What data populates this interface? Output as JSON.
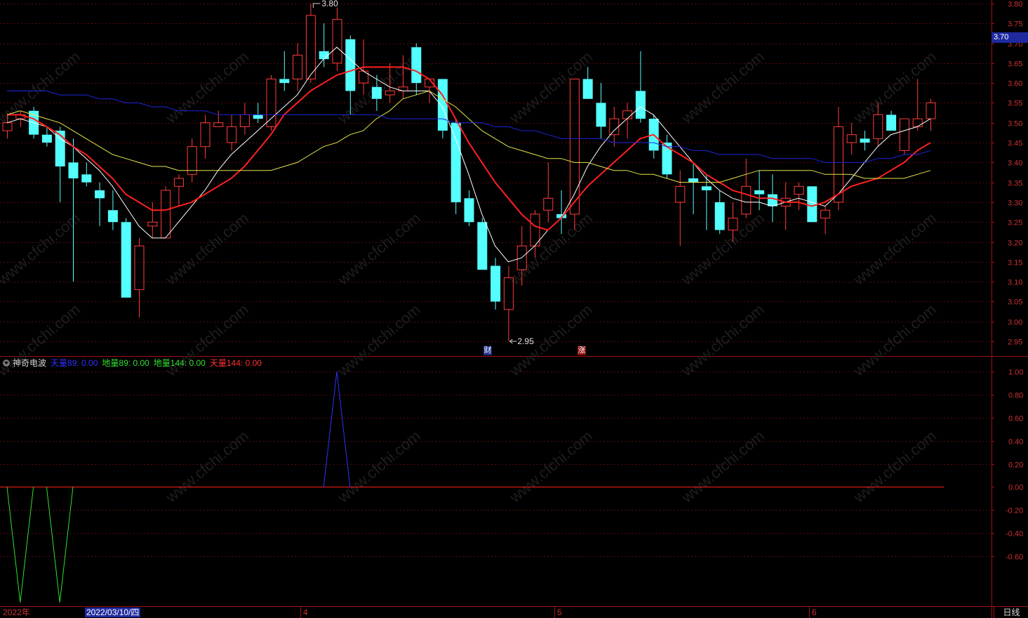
{
  "chart_data": [
    {
      "type": "candlestick",
      "ylim": [
        2.91,
        3.82
      ],
      "y_ticks": [
        "3.80",
        "3.75",
        "3.70",
        "3.65",
        "3.60",
        "3.55",
        "3.50",
        "3.45",
        "3.40",
        "3.35",
        "3.30",
        "3.25",
        "3.20",
        "3.15",
        "3.10",
        "3.05",
        "3.00",
        "2.95"
      ],
      "current_price": "3.70",
      "high_label": "3.80",
      "low_label": "2.95",
      "candles": [
        {
          "o": 3.48,
          "h": 3.52,
          "l": 3.46,
          "c": 3.5
        },
        {
          "o": 3.51,
          "h": 3.53,
          "l": 3.49,
          "c": 3.52
        },
        {
          "o": 3.53,
          "h": 3.54,
          "l": 3.46,
          "c": 3.47
        },
        {
          "o": 3.47,
          "h": 3.49,
          "l": 3.44,
          "c": 3.45
        },
        {
          "o": 3.48,
          "h": 3.49,
          "l": 3.3,
          "c": 3.39
        },
        {
          "o": 3.4,
          "h": 3.46,
          "l": 3.1,
          "c": 3.36
        },
        {
          "o": 3.37,
          "h": 3.4,
          "l": 3.34,
          "c": 3.35
        },
        {
          "o": 3.33,
          "h": 3.35,
          "l": 3.24,
          "c": 3.31
        },
        {
          "o": 3.28,
          "h": 3.33,
          "l": 3.23,
          "c": 3.25
        },
        {
          "o": 3.25,
          "h": 3.26,
          "l": 3.06,
          "c": 3.06
        },
        {
          "o": 3.08,
          "h": 3.21,
          "l": 3.01,
          "c": 3.19
        },
        {
          "o": 3.24,
          "h": 3.3,
          "l": 3.21,
          "c": 3.25
        },
        {
          "o": 3.21,
          "h": 3.34,
          "l": 3.21,
          "c": 3.33
        },
        {
          "o": 3.34,
          "h": 3.37,
          "l": 3.29,
          "c": 3.36
        },
        {
          "o": 3.37,
          "h": 3.46,
          "l": 3.35,
          "c": 3.44
        },
        {
          "o": 3.44,
          "h": 3.52,
          "l": 3.41,
          "c": 3.5
        },
        {
          "o": 3.49,
          "h": 3.53,
          "l": 3.49,
          "c": 3.5
        },
        {
          "o": 3.45,
          "h": 3.52,
          "l": 3.43,
          "c": 3.49
        },
        {
          "o": 3.49,
          "h": 3.55,
          "l": 3.47,
          "c": 3.52
        },
        {
          "o": 3.52,
          "h": 3.55,
          "l": 3.5,
          "c": 3.51
        },
        {
          "o": 3.49,
          "h": 3.62,
          "l": 3.48,
          "c": 3.61
        },
        {
          "o": 3.61,
          "h": 3.68,
          "l": 3.58,
          "c": 3.6
        },
        {
          "o": 3.61,
          "h": 3.7,
          "l": 3.58,
          "c": 3.67
        },
        {
          "o": 3.61,
          "h": 3.8,
          "l": 3.6,
          "c": 3.77
        },
        {
          "o": 3.68,
          "h": 3.75,
          "l": 3.64,
          "c": 3.66
        },
        {
          "o": 3.65,
          "h": 3.79,
          "l": 3.63,
          "c": 3.76
        },
        {
          "o": 3.71,
          "h": 3.72,
          "l": 3.52,
          "c": 3.58
        },
        {
          "o": 3.6,
          "h": 3.71,
          "l": 3.57,
          "c": 3.63
        },
        {
          "o": 3.59,
          "h": 3.62,
          "l": 3.53,
          "c": 3.56
        },
        {
          "o": 3.57,
          "h": 3.65,
          "l": 3.55,
          "c": 3.58
        },
        {
          "o": 3.58,
          "h": 3.67,
          "l": 3.56,
          "c": 3.59
        },
        {
          "o": 3.69,
          "h": 3.7,
          "l": 3.57,
          "c": 3.6
        },
        {
          "o": 3.59,
          "h": 3.61,
          "l": 3.55,
          "c": 3.61
        },
        {
          "o": 3.61,
          "h": 3.61,
          "l": 3.46,
          "c": 3.48
        },
        {
          "o": 3.5,
          "h": 3.51,
          "l": 3.27,
          "c": 3.3
        },
        {
          "o": 3.31,
          "h": 3.33,
          "l": 3.24,
          "c": 3.25
        },
        {
          "o": 3.25,
          "h": 3.26,
          "l": 3.13,
          "c": 3.13
        },
        {
          "o": 3.14,
          "h": 3.16,
          "l": 3.03,
          "c": 3.05
        },
        {
          "o": 3.03,
          "h": 3.14,
          "l": 2.95,
          "c": 3.11
        },
        {
          "o": 3.13,
          "h": 3.24,
          "l": 3.09,
          "c": 3.19
        },
        {
          "o": 3.19,
          "h": 3.28,
          "l": 3.16,
          "c": 3.27
        },
        {
          "o": 3.28,
          "h": 3.4,
          "l": 3.25,
          "c": 3.31
        },
        {
          "o": 3.27,
          "h": 3.33,
          "l": 3.22,
          "c": 3.26
        },
        {
          "o": 3.27,
          "h": 3.61,
          "l": 3.23,
          "c": 3.61
        },
        {
          "o": 3.61,
          "h": 3.64,
          "l": 3.56,
          "c": 3.56
        },
        {
          "o": 3.55,
          "h": 3.6,
          "l": 3.46,
          "c": 3.49
        },
        {
          "o": 3.47,
          "h": 3.54,
          "l": 3.44,
          "c": 3.51
        },
        {
          "o": 3.51,
          "h": 3.55,
          "l": 3.46,
          "c": 3.53
        },
        {
          "o": 3.58,
          "h": 3.68,
          "l": 3.5,
          "c": 3.51
        },
        {
          "o": 3.51,
          "h": 3.52,
          "l": 3.41,
          "c": 3.43
        },
        {
          "o": 3.45,
          "h": 3.47,
          "l": 3.36,
          "c": 3.37
        },
        {
          "o": 3.3,
          "h": 3.38,
          "l": 3.19,
          "c": 3.34
        },
        {
          "o": 3.36,
          "h": 3.4,
          "l": 3.27,
          "c": 3.35
        },
        {
          "o": 3.34,
          "h": 3.37,
          "l": 3.23,
          "c": 3.33
        },
        {
          "o": 3.3,
          "h": 3.33,
          "l": 3.22,
          "c": 3.23
        },
        {
          "o": 3.23,
          "h": 3.3,
          "l": 3.2,
          "c": 3.26
        },
        {
          "o": 3.27,
          "h": 3.41,
          "l": 3.26,
          "c": 3.34
        },
        {
          "o": 3.33,
          "h": 3.38,
          "l": 3.28,
          "c": 3.32
        },
        {
          "o": 3.32,
          "h": 3.37,
          "l": 3.25,
          "c": 3.29
        },
        {
          "o": 3.29,
          "h": 3.35,
          "l": 3.23,
          "c": 3.31
        },
        {
          "o": 3.32,
          "h": 3.35,
          "l": 3.28,
          "c": 3.34
        },
        {
          "o": 3.34,
          "h": 3.34,
          "l": 3.25,
          "c": 3.25
        },
        {
          "o": 3.26,
          "h": 3.29,
          "l": 3.22,
          "c": 3.28
        },
        {
          "o": 3.3,
          "h": 3.54,
          "l": 3.28,
          "c": 3.49
        },
        {
          "o": 3.45,
          "h": 3.5,
          "l": 3.42,
          "c": 3.47
        },
        {
          "o": 3.46,
          "h": 3.48,
          "l": 3.43,
          "c": 3.45
        },
        {
          "o": 3.46,
          "h": 3.55,
          "l": 3.44,
          "c": 3.52
        },
        {
          "o": 3.52,
          "h": 3.53,
          "l": 3.48,
          "c": 3.48
        },
        {
          "o": 3.43,
          "h": 3.51,
          "l": 3.42,
          "c": 3.51
        },
        {
          "o": 3.49,
          "h": 3.61,
          "l": 3.48,
          "c": 3.51
        },
        {
          "o": 3.51,
          "h": 3.56,
          "l": 3.48,
          "c": 3.55
        }
      ],
      "ma_lines": [
        {
          "color": "#ffffff",
          "values": [
            3.5,
            3.51,
            3.5,
            3.49,
            3.46,
            3.44,
            3.41,
            3.38,
            3.34,
            3.29,
            3.24,
            3.21,
            3.21,
            3.25,
            3.29,
            3.33,
            3.38,
            3.42,
            3.45,
            3.48,
            3.51,
            3.54,
            3.57,
            3.62,
            3.66,
            3.69,
            3.66,
            3.63,
            3.61,
            3.59,
            3.58,
            3.58,
            3.58,
            3.54,
            3.46,
            3.37,
            3.27,
            3.19,
            3.15,
            3.16,
            3.19,
            3.23,
            3.26,
            3.32,
            3.39,
            3.44,
            3.48,
            3.51,
            3.54,
            3.52,
            3.48,
            3.44,
            3.4,
            3.36,
            3.33,
            3.31,
            3.3,
            3.3,
            3.29,
            3.3,
            3.31,
            3.3,
            3.29,
            3.32,
            3.36,
            3.4,
            3.44,
            3.47,
            3.48,
            3.49,
            3.51
          ]
        },
        {
          "color": "#ff2020",
          "values": [
            3.52,
            3.52,
            3.51,
            3.49,
            3.47,
            3.44,
            3.42,
            3.39,
            3.36,
            3.32,
            3.3,
            3.28,
            3.28,
            3.29,
            3.3,
            3.32,
            3.34,
            3.36,
            3.39,
            3.43,
            3.47,
            3.52,
            3.55,
            3.58,
            3.6,
            3.62,
            3.63,
            3.64,
            3.64,
            3.64,
            3.64,
            3.63,
            3.61,
            3.57,
            3.51,
            3.45,
            3.4,
            3.35,
            3.31,
            3.27,
            3.24,
            3.23,
            3.26,
            3.3,
            3.34,
            3.37,
            3.4,
            3.43,
            3.46,
            3.47,
            3.44,
            3.42,
            3.4,
            3.37,
            3.35,
            3.33,
            3.32,
            3.31,
            3.31,
            3.3,
            3.3,
            3.29,
            3.3,
            3.32,
            3.34,
            3.35,
            3.36,
            3.38,
            3.4,
            3.43,
            3.45
          ]
        },
        {
          "color": "#e6e64a",
          "values": [
            3.52,
            3.53,
            3.52,
            3.51,
            3.5,
            3.48,
            3.46,
            3.44,
            3.42,
            3.41,
            3.4,
            3.39,
            3.39,
            3.38,
            3.38,
            3.38,
            3.38,
            3.38,
            3.38,
            3.38,
            3.38,
            3.39,
            3.4,
            3.42,
            3.44,
            3.45,
            3.47,
            3.48,
            3.51,
            3.53,
            3.56,
            3.57,
            3.58,
            3.56,
            3.54,
            3.51,
            3.48,
            3.46,
            3.44,
            3.43,
            3.42,
            3.41,
            3.41,
            3.4,
            3.4,
            3.39,
            3.38,
            3.38,
            3.37,
            3.37,
            3.36,
            3.35,
            3.35,
            3.35,
            3.35,
            3.36,
            3.37,
            3.38,
            3.38,
            3.38,
            3.38,
            3.38,
            3.37,
            3.37,
            3.37,
            3.36,
            3.36,
            3.36,
            3.36,
            3.37,
            3.38
          ]
        },
        {
          "color": "#1f24d8",
          "values": [
            3.58,
            3.58,
            3.58,
            3.58,
            3.57,
            3.57,
            3.57,
            3.56,
            3.56,
            3.55,
            3.55,
            3.54,
            3.54,
            3.53,
            3.53,
            3.53,
            3.52,
            3.52,
            3.52,
            3.52,
            3.52,
            3.52,
            3.52,
            3.52,
            3.52,
            3.52,
            3.52,
            3.52,
            3.52,
            3.51,
            3.51,
            3.51,
            3.51,
            3.51,
            3.5,
            3.5,
            3.5,
            3.49,
            3.49,
            3.48,
            3.48,
            3.47,
            3.46,
            3.46,
            3.46,
            3.46,
            3.45,
            3.45,
            3.45,
            3.45,
            3.44,
            3.44,
            3.43,
            3.43,
            3.42,
            3.42,
            3.42,
            3.42,
            3.41,
            3.41,
            3.41,
            3.41,
            3.4,
            3.4,
            3.4,
            3.4,
            3.41,
            3.41,
            3.42,
            3.42,
            3.43
          ]
        }
      ],
      "markers": [
        {
          "label": "财",
          "index": 38,
          "color": "#2d4fd6"
        },
        {
          "label": "涨",
          "index": 45,
          "color": "#c81414"
        }
      ]
    },
    {
      "type": "line",
      "title": "神奇电波",
      "ylim": [
        -1.0,
        1.1
      ],
      "y_ticks": [
        "1.00",
        "0.80",
        "0.60",
        "0.40",
        "0.20",
        "0.00",
        "-0.20",
        "-0.40",
        "-0.60"
      ],
      "series": [
        {
          "name": "天量89",
          "value_label": "0.00",
          "color": "#3030ff"
        },
        {
          "name": "地量89",
          "value_label": "0.00",
          "color": "#30e030"
        },
        {
          "name": "地量144",
          "value_label": "0.00",
          "color": "#30e030"
        },
        {
          "name": "天量144",
          "value_label": "0.00",
          "color": "#ff3030"
        }
      ],
      "spikes": [
        {
          "series": "地量89",
          "index": 1,
          "value": -1.0
        },
        {
          "series": "地量89",
          "index": 4,
          "value": -1.0
        },
        {
          "series": "天量89",
          "index": 25,
          "value": 1.0
        }
      ]
    }
  ],
  "x_axis": {
    "labels": [
      "2022年",
      "4",
      "5",
      "6"
    ],
    "highlight_date": "2022/03/10/四",
    "period_label": "日线"
  },
  "watermark": "www.cfchi.com",
  "colors": {
    "up": "#ff3b3b",
    "down": "#54ffff",
    "grid": "#5a0a0a",
    "axis": "#a01010",
    "tick": "#c83232"
  }
}
